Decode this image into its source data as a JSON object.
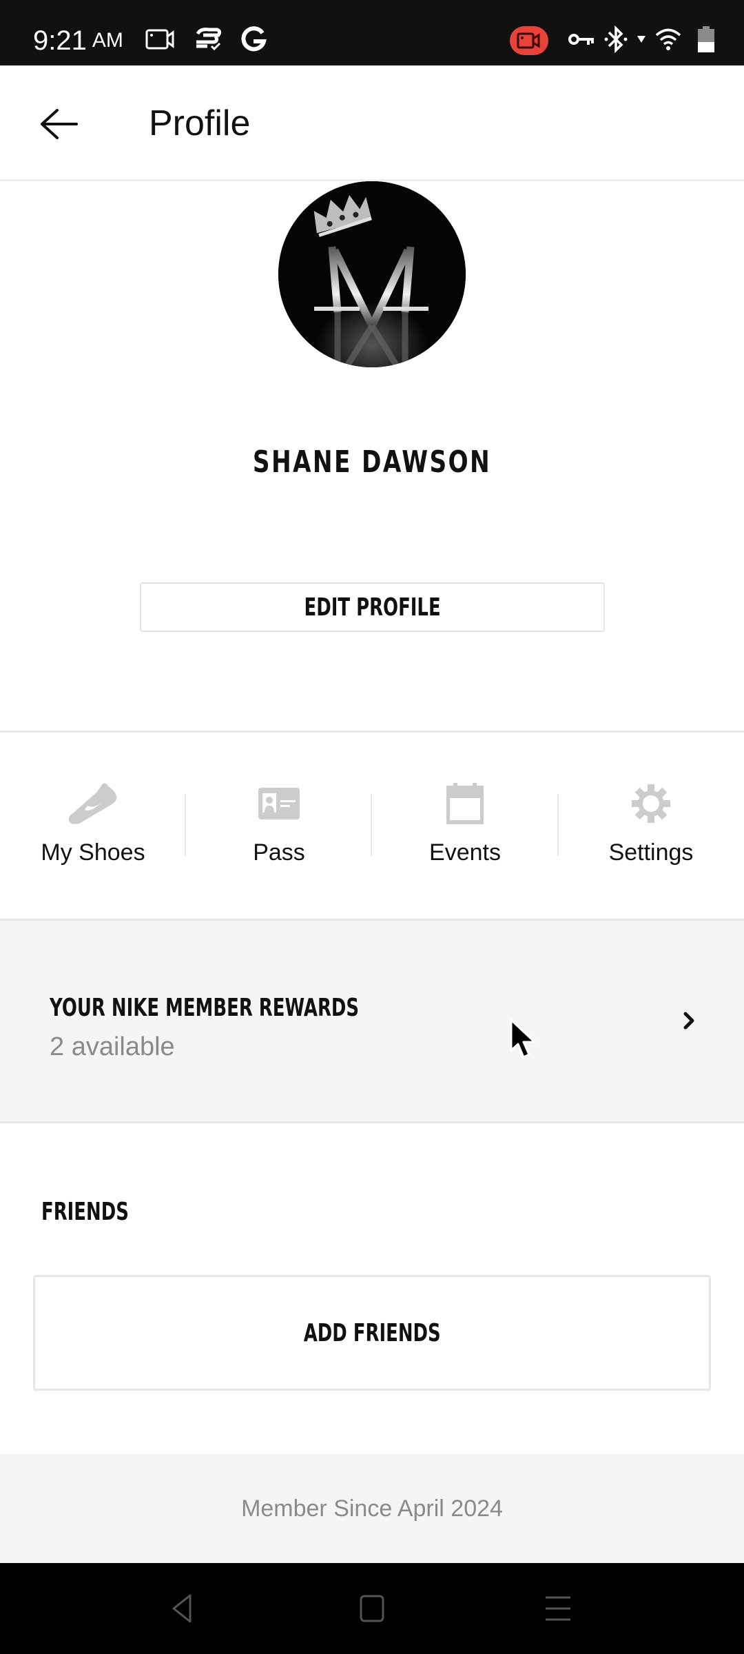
{
  "status_bar": {
    "time": "9:21",
    "ampm": "AM",
    "left_icons": [
      "screen-record-icon",
      "cloud-sync-icon",
      "google-icon"
    ],
    "right_icons": [
      "recording-indicator-icon",
      "vpn-key-icon",
      "bluetooth-icon",
      "data-arrow-icon",
      "wifi-icon",
      "battery-icon"
    ],
    "recording_color": "#e8433a"
  },
  "header": {
    "back_icon": "arrow-left-icon",
    "title": "Profile"
  },
  "profile": {
    "avatar_icon": "monogram-m-crown-avatar",
    "name": "SHANE DAWSON",
    "edit_button": "EDIT PROFILE"
  },
  "quick_links": [
    {
      "label": "My Shoes",
      "icon": "shoe-icon"
    },
    {
      "label": "Pass",
      "icon": "id-card-icon"
    },
    {
      "label": "Events",
      "icon": "calendar-icon"
    },
    {
      "label": "Settings",
      "icon": "gear-icon"
    }
  ],
  "rewards": {
    "title": "YOUR NIKE MEMBER REWARDS",
    "subtitle": "2 available",
    "chevron_icon": "chevron-right-icon"
  },
  "friends": {
    "heading": "FRIENDS",
    "add_button": "ADD FRIENDS"
  },
  "footer": {
    "member_since": "Member Since April 2024"
  },
  "nav_bar": {
    "back": "nav-back-icon",
    "home": "nav-home-icon",
    "recents": "nav-recents-icon"
  },
  "colors": {
    "text_primary": "#111111",
    "text_secondary": "#8a8a8a",
    "icon_gray": "#cccccc",
    "section_bg": "#f5f5f5",
    "divider": "#e6e6e6"
  }
}
